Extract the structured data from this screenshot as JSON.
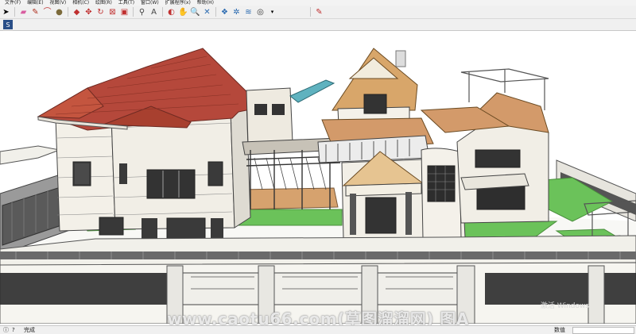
{
  "menubar": {
    "items": [
      "文件(F)",
      "编辑(E)",
      "视图(V)",
      "相机(C)",
      "绘图(R)",
      "工具(T)",
      "窗口(W)",
      "扩展程序(x)",
      "帮助(H)"
    ]
  },
  "toolbar": {
    "icons": [
      "select-arrow-icon",
      "eraser-icon",
      "line-pencil-icon",
      "arc-icon",
      "paint-bucket-icon",
      "pushpull-icon",
      "move-icon",
      "rotate-icon",
      "scale-icon",
      "offset-icon",
      "tape-measure-icon",
      "text-icon",
      "orbit-icon",
      "pan-icon",
      "zoom-icon",
      "zoom-extents-icon",
      "warehouse-icon",
      "extension-icon",
      "account-icon",
      "style-icon"
    ]
  },
  "toolbar2": {
    "icons": [
      "sketchup-logo-icon"
    ]
  },
  "watermark": {
    "text": "www.caotu66.com(草图溜溜网) 图A",
    "os_text": "激活 Windows"
  },
  "status": {
    "icons": [
      "info-icon",
      "help-icon"
    ],
    "text": "完成",
    "measure_label": "数值"
  },
  "colors": {
    "roof": "#b5483b",
    "lawn": "#6bc25a",
    "wall": "#f1eee6",
    "glass": "#5fb2bf",
    "wood_floor": "#d6a26e",
    "fence": "#4a4a4a"
  }
}
